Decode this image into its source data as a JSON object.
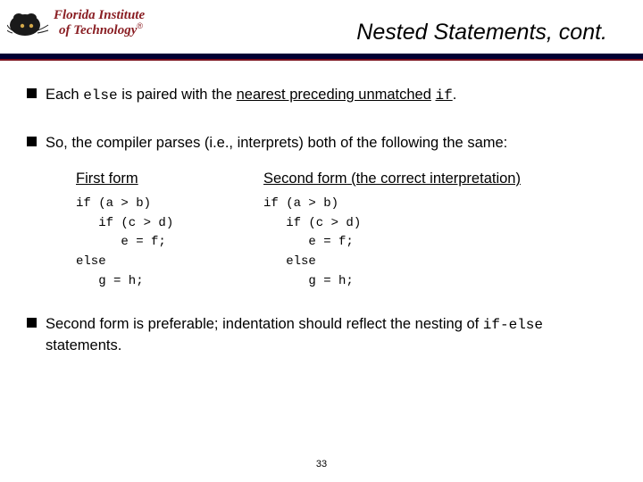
{
  "logo": {
    "line1": "Florida Institute",
    "line2": "of Technology",
    "reg": "®"
  },
  "title": "Nested Statements, cont.",
  "bullets": {
    "b1_pre": "Each ",
    "b1_code1": "else",
    "b1_mid": " is paired with the ",
    "b1_und": "nearest preceding unmatched",
    "b1_space": " ",
    "b1_code2": "if",
    "b1_post": ".",
    "b2": "So, the compiler parses (i.e., interprets) both of the following the same:",
    "b3_pre": "Second form is preferable; indentation should reflect the nesting of ",
    "b3_code": "if-else",
    "b3_post": " statements."
  },
  "forms": {
    "first_label": "First form",
    "second_label": "Second form",
    "second_note": " (the correct interpretation)",
    "code1_l1": "if (a > b)",
    "code1_l2": "   if (c > d)",
    "code1_l3": "      e = f;",
    "code1_l4": "else",
    "code1_l5": "   g = h;",
    "code2_l1": "if (a > b)",
    "code2_l2": "   if (c > d)",
    "code2_l3": "      e = f;",
    "code2_l4": "   else",
    "code2_l5": "      g = h;"
  },
  "page_number": "33"
}
